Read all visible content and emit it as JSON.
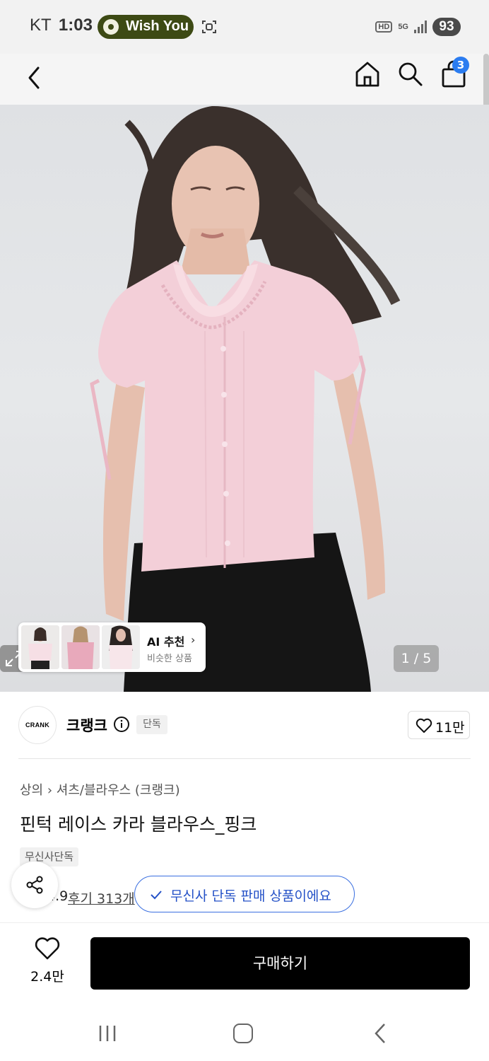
{
  "status_bar": {
    "carrier": "KT",
    "time": "1:03",
    "media_pill": "Wish You",
    "hd": "HD",
    "network": "5G",
    "battery": "93"
  },
  "header": {
    "cart_count": "3"
  },
  "gallery": {
    "counter": "1 / 5",
    "ai_title": "AI 추천",
    "ai_subtitle": "비슷한 상품"
  },
  "brand": {
    "logo_text": "CRANK",
    "name": "크랭크",
    "exclusive_tag": "단독",
    "likes": "11만"
  },
  "product": {
    "breadcrumb": "상의  ›  셔츠/블라우스 (크랭크)",
    "title": "핀턱 레이스 카라 블라우스_핑크",
    "exclusive_badge": "무신사단독",
    "rating": "4.9",
    "reviews": "후기 313개"
  },
  "toast": {
    "message": "무신사 단독 판매 상품이에요"
  },
  "bottom": {
    "wish_count": "2.4만",
    "buy_label": "구매하기"
  }
}
